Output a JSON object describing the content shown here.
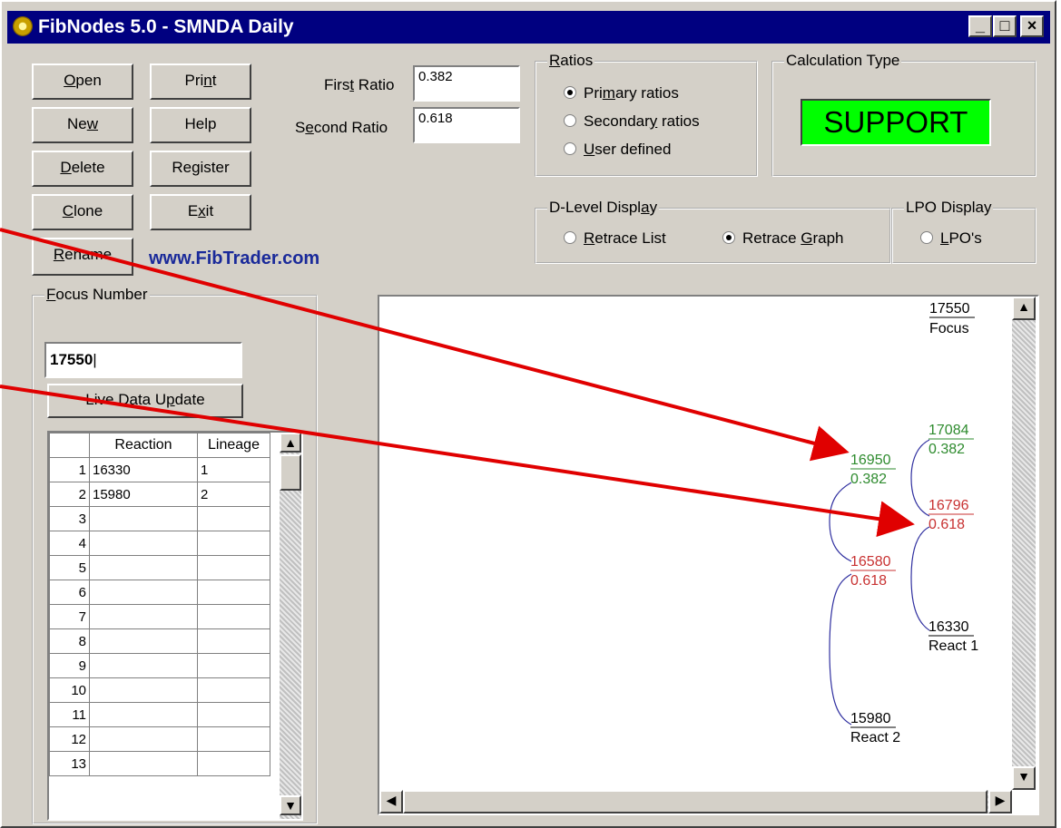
{
  "window": {
    "title": "FibNodes 5.0 - SMNDA Daily",
    "controls": [
      "_",
      "□",
      "×"
    ]
  },
  "buttons": {
    "open": "Open",
    "print": "Print",
    "new": "New",
    "help": "Help",
    "delete": "Delete",
    "register": "Register",
    "clone": "Clone",
    "exit": "Exit",
    "rename": "Rename",
    "live_update": "Live Data Update"
  },
  "website": "www.FibTrader.com",
  "ratios_fields": {
    "first_label": "First Ratio",
    "first_value": "0.382",
    "second_label": "Second Ratio",
    "second_value": "0.618"
  },
  "ratios_group": {
    "title": "Ratios",
    "options": [
      "Primary ratios",
      "Secondary ratios",
      "User defined"
    ],
    "selected": 0
  },
  "calc_group": {
    "title": "Calculation Type",
    "value": "SUPPORT",
    "color": "#00ff00"
  },
  "dlevel_group": {
    "title": "D-Level Display",
    "options": [
      "Retrace List",
      "Retrace Graph"
    ],
    "selected": 1
  },
  "lpo_group": {
    "title": "LPO Display",
    "option": "LPO's"
  },
  "focus_group": {
    "title": "Focus Number",
    "value": "17550"
  },
  "grid": {
    "headers": [
      "",
      "Reaction",
      "Lineage"
    ],
    "rows": [
      [
        "1",
        "16330",
        "1"
      ],
      [
        "2",
        "15980",
        "2"
      ],
      [
        "3",
        "",
        ""
      ],
      [
        "4",
        "",
        ""
      ],
      [
        "5",
        "",
        ""
      ],
      [
        "6",
        "",
        ""
      ],
      [
        "7",
        "",
        ""
      ],
      [
        "8",
        "",
        ""
      ],
      [
        "9",
        "",
        ""
      ],
      [
        "10",
        "",
        ""
      ],
      [
        "11",
        "",
        ""
      ],
      [
        "12",
        "",
        ""
      ],
      [
        "13",
        "",
        ""
      ]
    ]
  },
  "graph": {
    "focus": {
      "value": "17550",
      "label": "Focus"
    },
    "nodes": [
      {
        "id": "n1",
        "top": "17084",
        "bottom": "0.382",
        "color": "#2e8b2e"
      },
      {
        "id": "n2",
        "top": "16950",
        "bottom": "0.382",
        "color": "#2e8b2e"
      },
      {
        "id": "n3",
        "top": "16796",
        "bottom": "0.618",
        "color": "#c83232"
      },
      {
        "id": "n4",
        "top": "16580",
        "bottom": "0.618",
        "color": "#c83232"
      },
      {
        "id": "n5",
        "top": "16330",
        "bottom": "React 1",
        "color": "#000000"
      },
      {
        "id": "n6",
        "top": "15980",
        "bottom": "React 2",
        "color": "#000000"
      }
    ],
    "bracket_color": "#3030a0"
  },
  "annotation_arrow_color": "#e00000"
}
